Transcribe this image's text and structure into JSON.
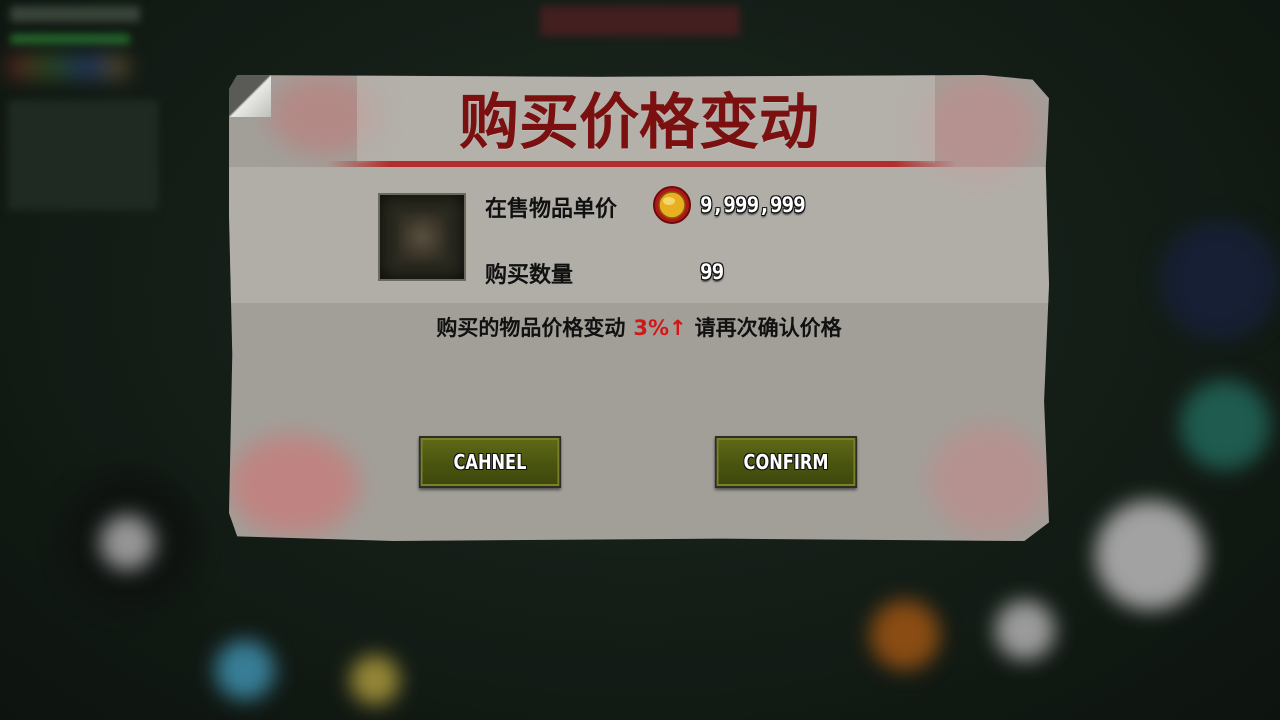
{
  "dialog": {
    "title": "购买价格变动",
    "unit_price_label": "在售物品单价",
    "unit_price_value": "9,999,999",
    "currency_icon": "gold-coin-icon",
    "quantity_label": "购买数量",
    "quantity_value": "99",
    "notice_prefix": "购买的物品价格变动",
    "notice_change": "3%↑",
    "notice_suffix": "请再次确认价格",
    "cancel_label": "CAHNEL",
    "confirm_label": "CONFIRM"
  },
  "colors": {
    "title": "#7a1010",
    "price_change": "#d01818",
    "button_green": "#4a5410",
    "paper": "#a29f99"
  }
}
